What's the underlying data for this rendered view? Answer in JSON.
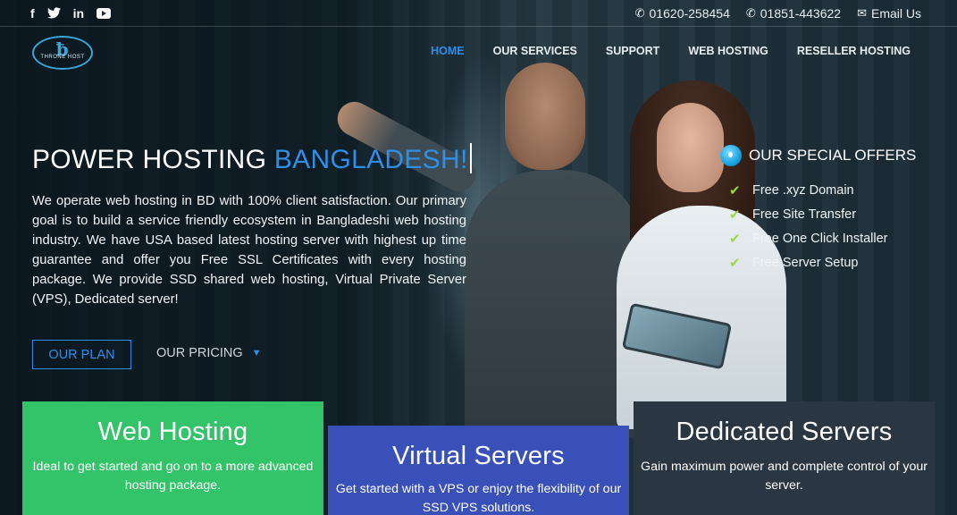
{
  "topbar": {
    "social": [
      {
        "icon": "facebook-icon",
        "glyph": "f"
      },
      {
        "icon": "twitter-icon",
        "glyph": "🐦"
      },
      {
        "icon": "linkedin-icon",
        "glyph": "in"
      },
      {
        "icon": "youtube-icon",
        "glyph": ""
      }
    ],
    "phone1": "01620-258454",
    "phone2": "01851-443622",
    "email": "Email Us"
  },
  "navbar": {
    "logo_text": "THRONE HOST",
    "items": [
      "HOME",
      "OUR SERVICES",
      "SUPPORT",
      "WEB HOSTING",
      "RESELLER HOSTING"
    ],
    "active_index": 0
  },
  "hero": {
    "title_main": "POWER HOSTING ",
    "title_highlight": "BANGLADESH!",
    "description": "We operate web hosting in BD with 100% client satisfaction. Our primary goal is to build a service friendly ecosystem in Bangladeshi web hosting industry. We have USA based latest hosting server with highest up time guarantee and offer you Free SSL Certificates with every hosting package. We provide SSD shared web hosting, Virtual Private Server (VPS), Dedicated server!",
    "plan_button": "OUR PLAN",
    "pricing_button": "OUR PRICING"
  },
  "offers": {
    "title": "OUR SPECIAL OFFERS",
    "items": [
      "Free .xyz Domain",
      "Free Site Transfer",
      "Free One Click Installer",
      "Free Server Setup"
    ]
  },
  "cards": {
    "web": {
      "title": "Web Hosting",
      "text": "Ideal to get started and go on to a more advanced hosting package.",
      "color": "#33c46a"
    },
    "vps": {
      "title": "Virtual Servers",
      "text": "Get started with a VPS or enjoy the flexibility of our SSD VPS solutions.",
      "color": "#3950b8"
    },
    "dedicated": {
      "title": "Dedicated Servers",
      "text": "Gain maximum power and complete control of your server.",
      "color": "#2a3642"
    }
  },
  "colors": {
    "accent": "#2f8fe8",
    "check": "#9ad84a"
  }
}
